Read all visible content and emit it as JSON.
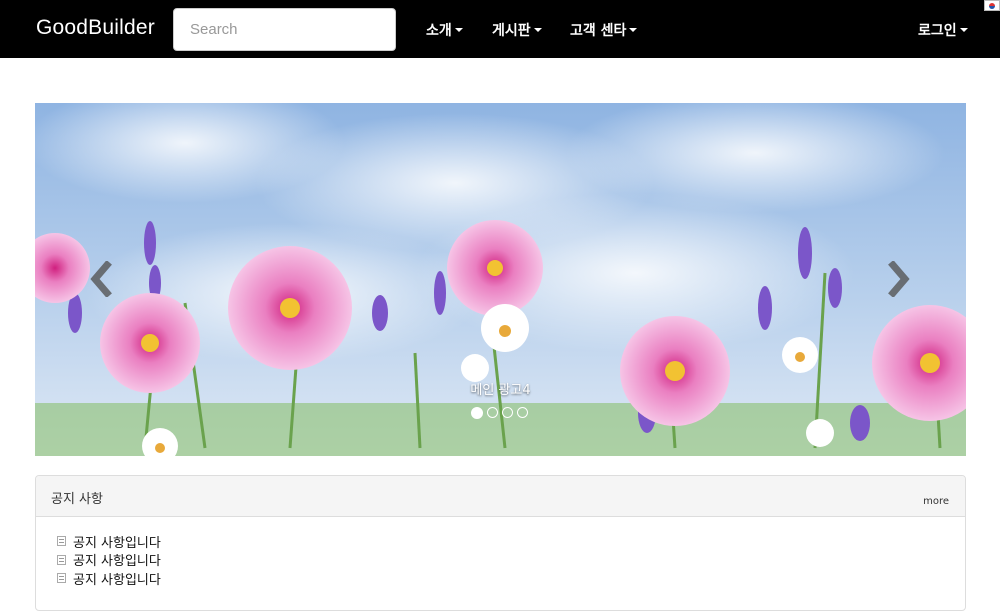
{
  "navbar": {
    "brand": "GoodBuilder",
    "search_placeholder": "Search",
    "menu": [
      "소개",
      "게시판",
      "고객 센타"
    ],
    "login": "로그인"
  },
  "carousel": {
    "caption": "메인 광고4",
    "slide_count": 4,
    "active_index": 0
  },
  "notice": {
    "title": "공지 사항",
    "more": "more",
    "items": [
      "공지 사항입니다",
      "공지 사항입니다",
      "공지 사항입니다"
    ]
  },
  "colors": {
    "navbar_bg": "#000000",
    "panel_heading_bg": "#f5f5f5"
  }
}
